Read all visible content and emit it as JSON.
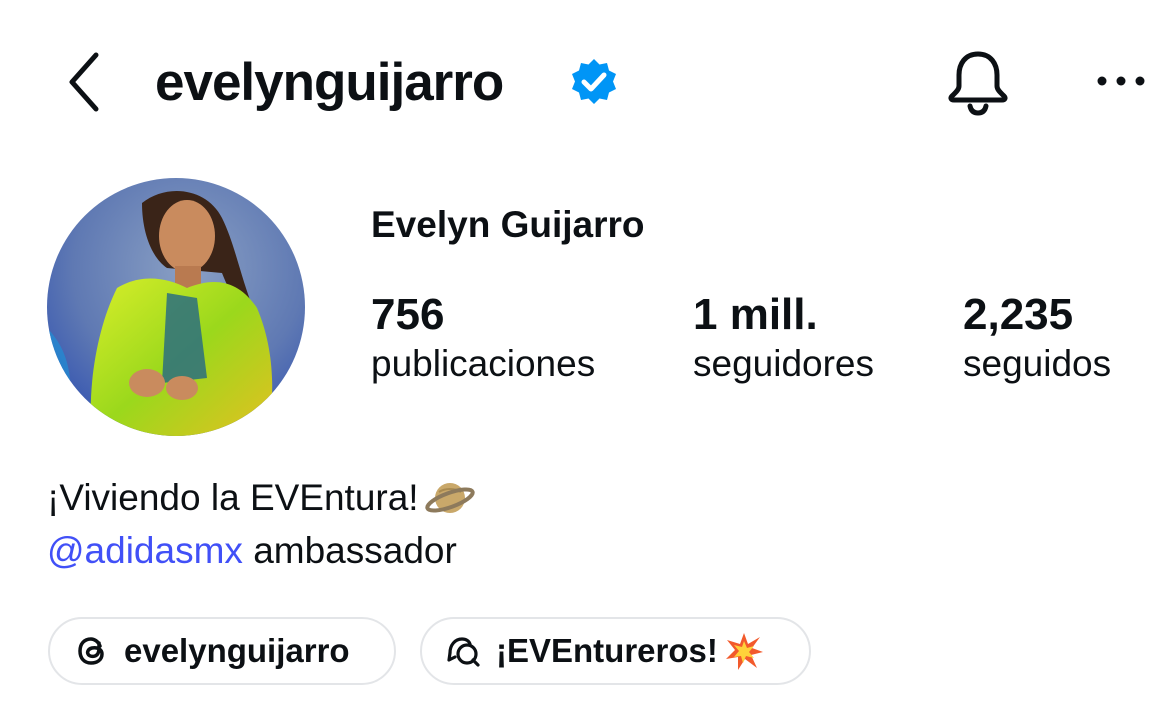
{
  "header": {
    "username": "evelynguijarro",
    "icons": [
      "back-chevron-icon",
      "verified-badge-icon",
      "bell-icon",
      "more-options-icon"
    ]
  },
  "profile": {
    "full_name": "Evelyn Guijarro",
    "stats": [
      {
        "value": "756",
        "label": "publicaciones"
      },
      {
        "value": "1 mill.",
        "label": "seguidores"
      },
      {
        "value": "2,235",
        "label": "seguidos"
      }
    ]
  },
  "bio": {
    "line1": "¡Viviendo la EVEntura!",
    "line1_emoji": "ringed-planet-emoji",
    "mention": "@adidasmx",
    "line2_rest": " ambassador"
  },
  "chips": {
    "threads": {
      "label": "evelynguijarro",
      "icon": "threads-icon"
    },
    "channel": {
      "label": "¡EVEntureros!",
      "icon": "broadcast-chat-icon",
      "emoji": "collision-emoji"
    }
  },
  "colors": {
    "text": "#0c1014",
    "verified": "#0095f6",
    "mention": "#4150f7",
    "chip_border": "#e3e5e8"
  }
}
